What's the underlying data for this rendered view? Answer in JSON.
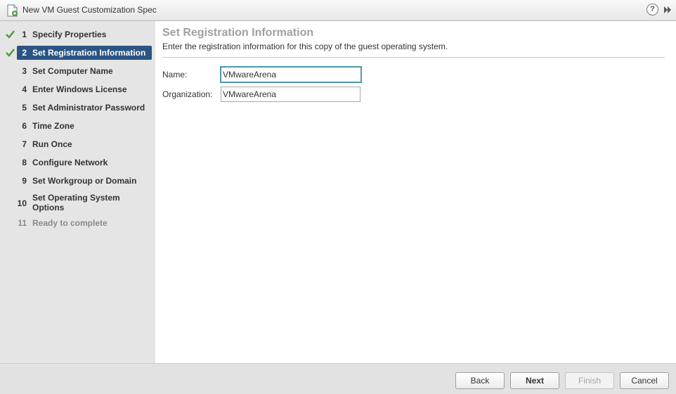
{
  "window": {
    "title": "New VM Guest Customization Spec",
    "help_symbol": "?"
  },
  "steps": [
    {
      "number": "1",
      "label": "Specify Properties",
      "state": "completed"
    },
    {
      "number": "2",
      "label": "Set Registration Information",
      "state": "current"
    },
    {
      "number": "3",
      "label": "Set Computer Name",
      "state": "pending"
    },
    {
      "number": "4",
      "label": "Enter Windows License",
      "state": "pending"
    },
    {
      "number": "5",
      "label": "Set Administrator Password",
      "state": "pending"
    },
    {
      "number": "6",
      "label": "Time Zone",
      "state": "pending"
    },
    {
      "number": "7",
      "label": "Run Once",
      "state": "pending"
    },
    {
      "number": "8",
      "label": "Configure Network",
      "state": "pending"
    },
    {
      "number": "9",
      "label": "Set Workgroup or Domain",
      "state": "pending"
    },
    {
      "number": "10",
      "label": "Set Operating System Options",
      "state": "pending"
    },
    {
      "number": "11",
      "label": "Ready to complete",
      "state": "disabled"
    }
  ],
  "page": {
    "title": "Set Registration Information",
    "description": "Enter the registration information for this copy of the guest operating system.",
    "name_label": "Name:",
    "name_value": "VMwareArena",
    "org_label": "Organization:",
    "org_value": "VMwareArena"
  },
  "footer": {
    "back": "Back",
    "next": "Next",
    "finish": "Finish",
    "cancel": "Cancel"
  },
  "colors": {
    "active_step": "#2a5482",
    "check": "#4a9e3a",
    "focus_border": "#4e98ad",
    "sidebar_bg": "#e5e5e5"
  }
}
